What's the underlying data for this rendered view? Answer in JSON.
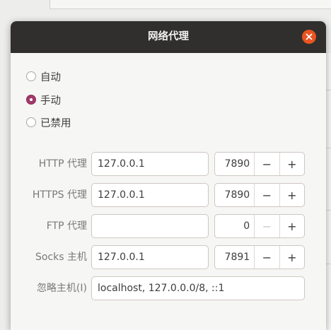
{
  "dialog": {
    "title": "网络代理"
  },
  "modes": [
    {
      "label": "自动",
      "checked": false
    },
    {
      "label": "手动",
      "checked": true
    },
    {
      "label": "已禁用",
      "checked": false
    }
  ],
  "proxies": {
    "http": {
      "label": "HTTP 代理",
      "host": "127.0.0.1",
      "port": "7890"
    },
    "https": {
      "label": "HTTPS 代理",
      "host": "127.0.0.1",
      "port": "7890"
    },
    "ftp": {
      "label": "FTP 代理",
      "host": "",
      "port": "0"
    },
    "socks": {
      "label": "Socks 主机",
      "host": "127.0.0.1",
      "port": "7891"
    }
  },
  "ignore": {
    "label": "忽略主机(I)",
    "value": "localhost, 127.0.0.0/8, ::1"
  },
  "spin_symbols": {
    "decrement": "−",
    "increment": "+"
  },
  "colors": {
    "accent_close": "#e95420",
    "radio_checked": "#a1396a",
    "titlebar": "#302f2d"
  }
}
